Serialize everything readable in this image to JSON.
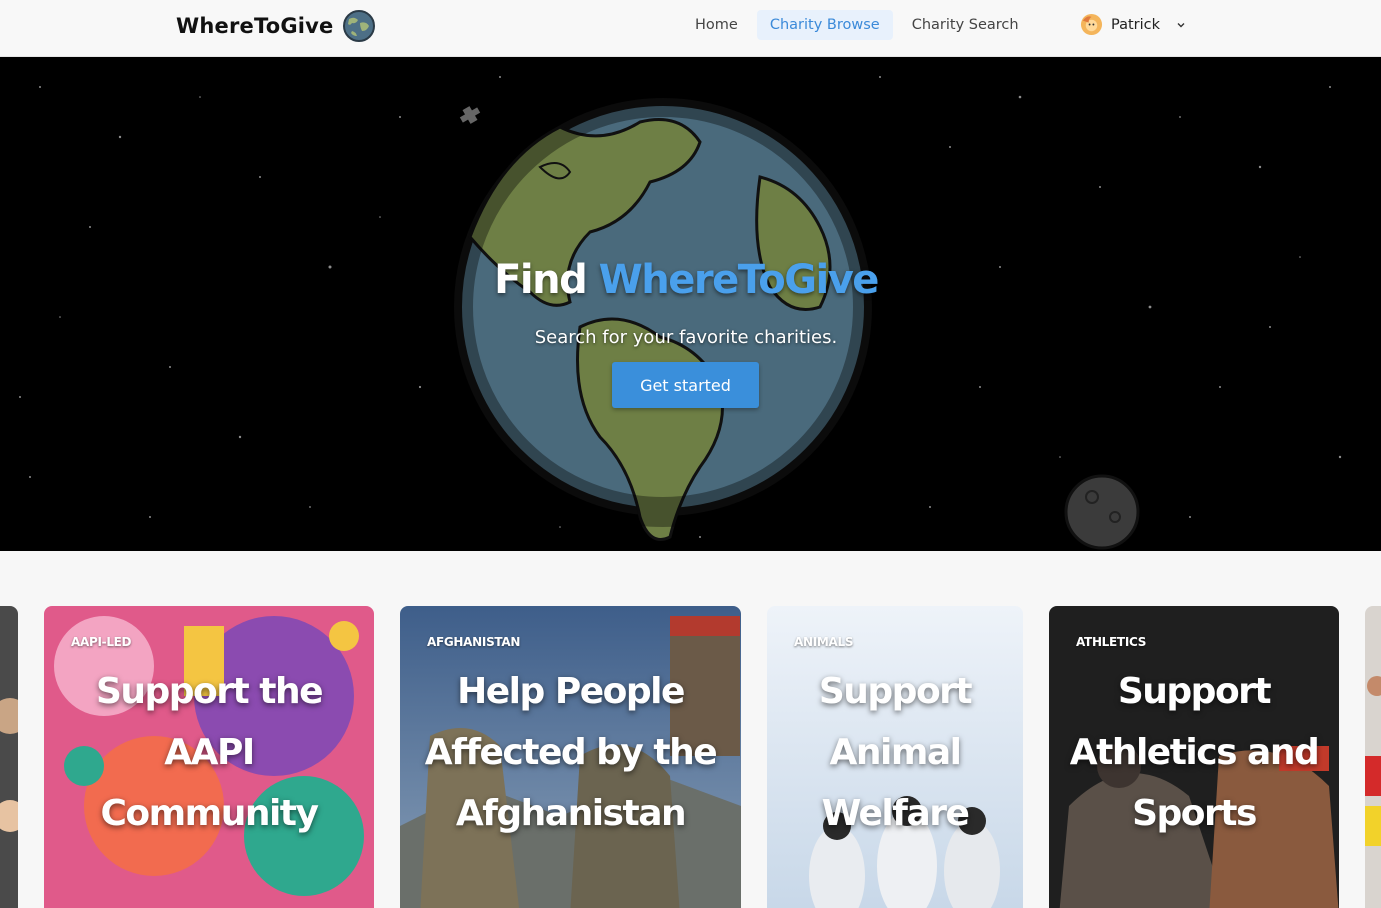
{
  "navbar": {
    "brand": "WhereToGive",
    "links": [
      {
        "label": "Home",
        "active": false
      },
      {
        "label": "Charity Browse",
        "active": true
      },
      {
        "label": "Charity Search",
        "active": false
      }
    ],
    "user": {
      "name": "Patrick"
    }
  },
  "hero": {
    "title_prefix": "Find",
    "title_accent": "WhereToGive",
    "subtitle": "Search for your favorite charities.",
    "cta_label": "Get started"
  },
  "cards": [
    {
      "category": "AAPI-LED",
      "title": "Support the AAPI Community"
    },
    {
      "category": "AFGHANISTAN",
      "title": "Help People Affected by the Afghanistan"
    },
    {
      "category": "ANIMALS",
      "title": "Support Animal Welfare"
    },
    {
      "category": "ATHLETICS",
      "title": "Support Athletics and Sports"
    }
  ],
  "colors": {
    "accent": "#3a8fdb",
    "brand_text": "#111111",
    "hero_bg": "#000000",
    "nav_active_bg": "#e8f1fc",
    "nav_active_text": "#3b8ad9"
  },
  "icons": {
    "brand": "globe-icon",
    "avatar": "user-avatar-icon",
    "dropdown": "chevron-down-icon"
  }
}
